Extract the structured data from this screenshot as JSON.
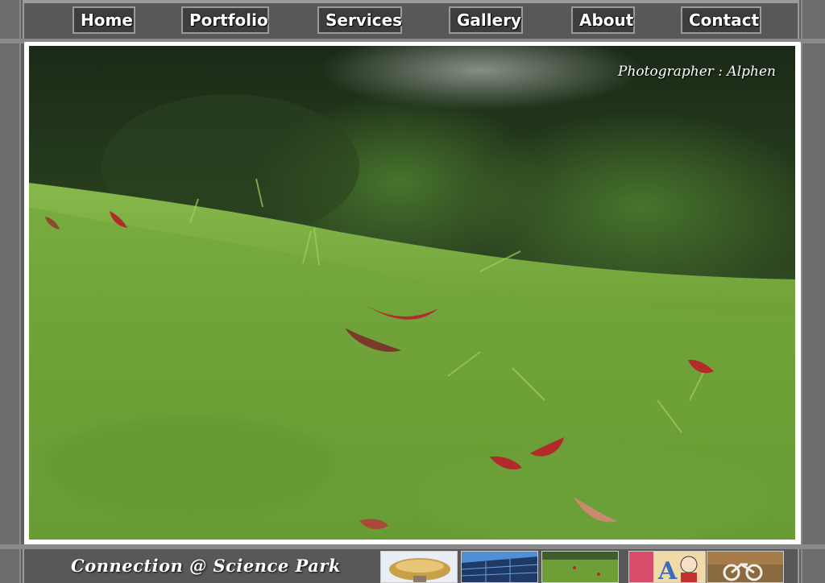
{
  "nav": {
    "items": [
      {
        "label": "Home"
      },
      {
        "label": "Portfolio"
      },
      {
        "label": "Services"
      },
      {
        "label": "Gallery"
      },
      {
        "label": "About"
      },
      {
        "label": "Contact"
      }
    ]
  },
  "photo": {
    "credit": "Photographer : Alphen"
  },
  "footer": {
    "caption": "Connection @ Science Park",
    "thumbnails": [
      {
        "name": "thumb-architecture-dome"
      },
      {
        "name": "thumb-glass-building"
      },
      {
        "name": "thumb-grass-field"
      },
      {
        "name": "thumb-cartoon-art"
      },
      {
        "name": "thumb-bicycle-sign"
      }
    ]
  },
  "colors": {
    "frame": "#5f5f5f",
    "border": "#9a9a9a",
    "grass": "#6fa23a"
  }
}
